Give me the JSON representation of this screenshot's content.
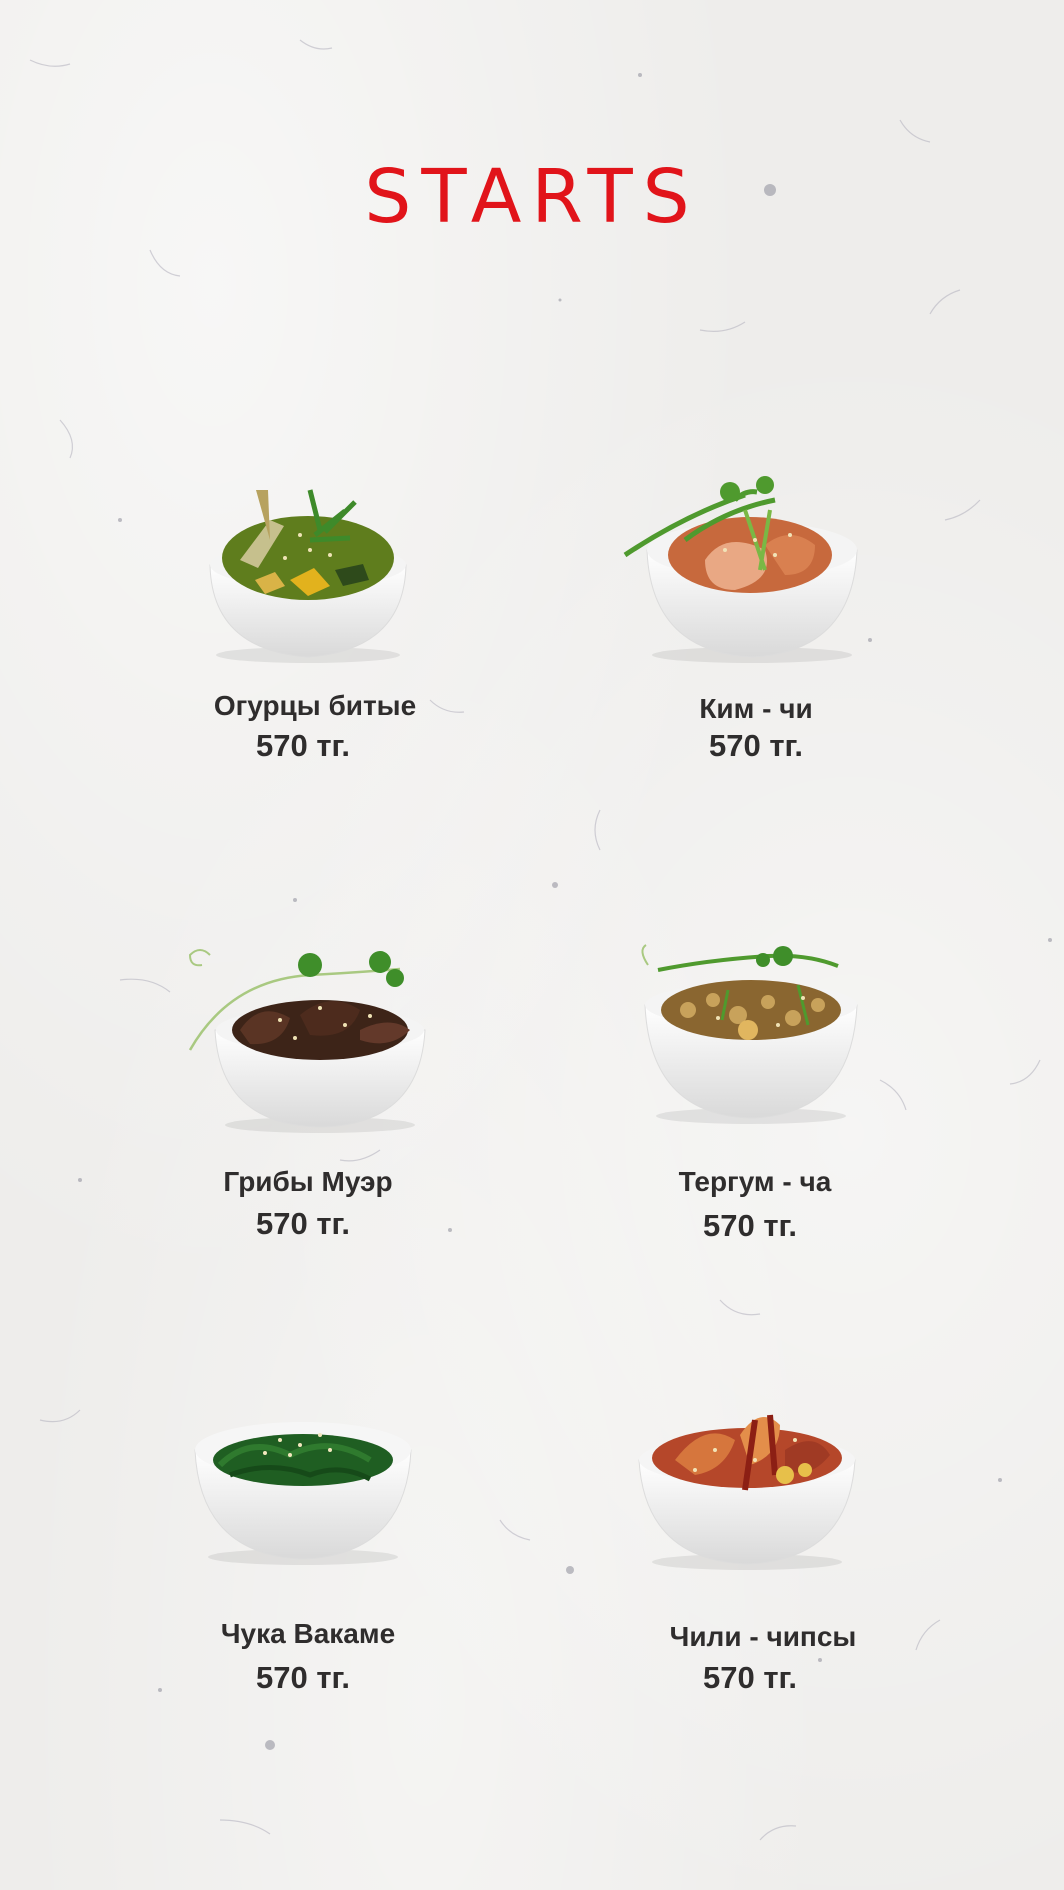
{
  "menu": {
    "title": "STARTS",
    "items": [
      {
        "name": "Огурцы битые",
        "price": "570 тг.",
        "icon": "cucumber-salad-bowl-icon",
        "color": "#6b8f2a"
      },
      {
        "name": "Ким - чи",
        "price": "570 тг.",
        "icon": "kimchi-bowl-icon",
        "color": "#c56a3c"
      },
      {
        "name": "Грибы Муэр",
        "price": "570 тг.",
        "icon": "mushroom-bowl-icon",
        "color": "#3d2418"
      },
      {
        "name": "Тергум - ча",
        "price": "570 тг.",
        "icon": "tergum-cha-bowl-icon",
        "color": "#8a6630"
      },
      {
        "name": "Чука Вакаме",
        "price": "570 тг.",
        "icon": "seaweed-salad-bowl-icon",
        "color": "#1f5e22"
      },
      {
        "name": "Чили - чипсы",
        "price": "570 тг.",
        "icon": "chili-chips-bowl-icon",
        "color": "#b5472a"
      }
    ]
  },
  "colors": {
    "accent": "#e1141a",
    "text": "#2f2d2d",
    "background": "#eeedeb"
  }
}
